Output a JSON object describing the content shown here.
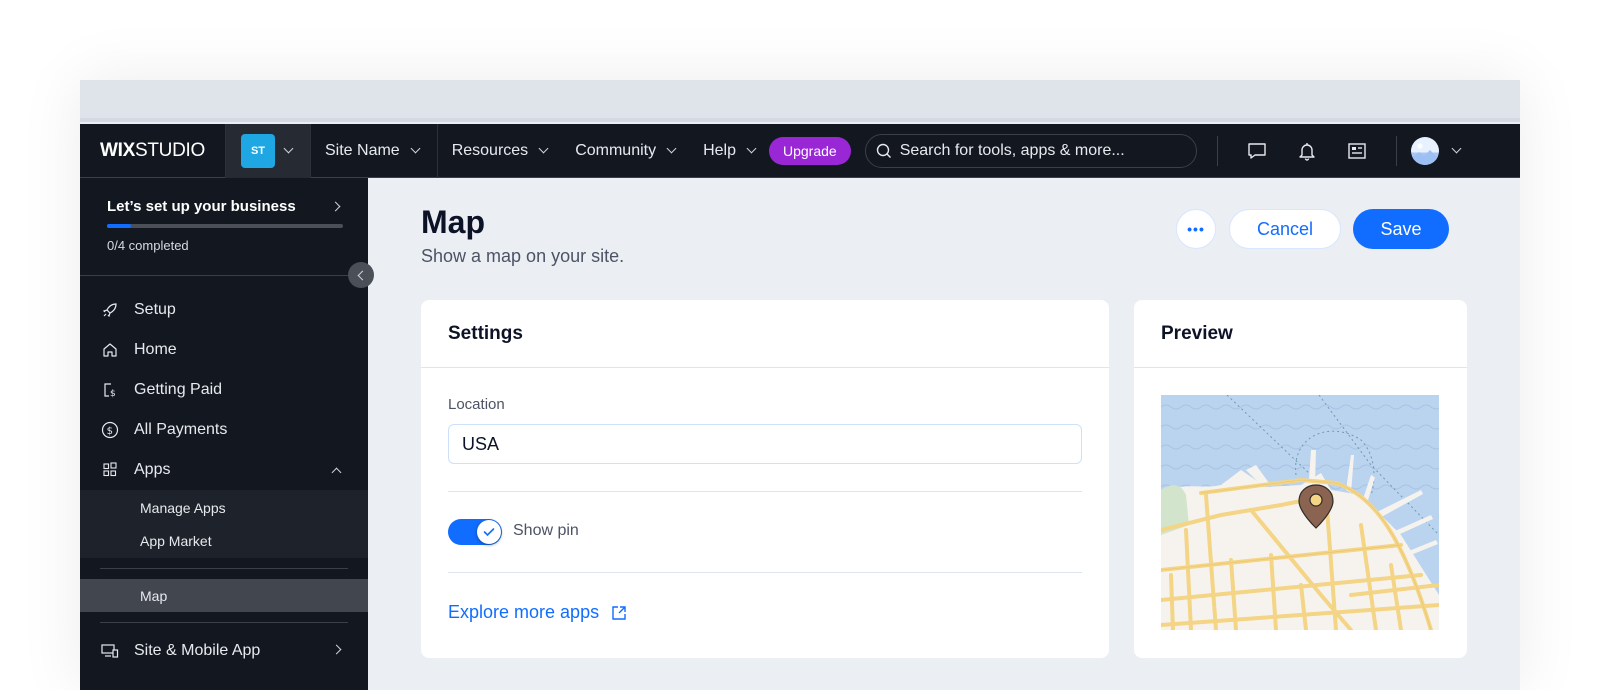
{
  "topbar": {
    "logo_bold": "WIX",
    "logo_light": "STUDIO",
    "site_badge": "ST",
    "site_name": "Site Name",
    "nav": [
      "Resources",
      "Community",
      "Help"
    ],
    "upgrade_label": "Upgrade",
    "search_placeholder": "Search for tools, apps & more...",
    "icons": [
      "chat-icon",
      "bell-icon",
      "news-icon"
    ],
    "colors": {
      "upgrade": "#9a27d5",
      "site_badge": "#1ea7e2"
    }
  },
  "sidebar": {
    "setup_title": "Let’s set up your business",
    "setup_progress_fraction": 0.1,
    "setup_count": "0/4 completed",
    "items": [
      {
        "label": "Setup",
        "icon": "rocket-icon"
      },
      {
        "label": "Home",
        "icon": "home-icon"
      },
      {
        "label": "Getting Paid",
        "icon": "invoice-icon"
      },
      {
        "label": "All Payments",
        "icon": "dollar-circle-icon"
      },
      {
        "label": "Apps",
        "icon": "apps-icon"
      }
    ],
    "apps_sub": [
      "Manage Apps",
      "App Market"
    ],
    "active_item": "Map",
    "bottom_item": {
      "label": "Site & Mobile App",
      "icon": "devices-icon"
    }
  },
  "page": {
    "title": "Map",
    "subtitle": "Show a map on your site.",
    "more_label": "•••",
    "cancel_label": "Cancel",
    "save_label": "Save",
    "accent": "#116dff"
  },
  "settings": {
    "title": "Settings",
    "location_label": "Location",
    "location_value": "USA",
    "show_pin_label": "Show pin",
    "show_pin_on": true,
    "explore_label": "Explore more apps"
  },
  "preview": {
    "title": "Preview"
  }
}
